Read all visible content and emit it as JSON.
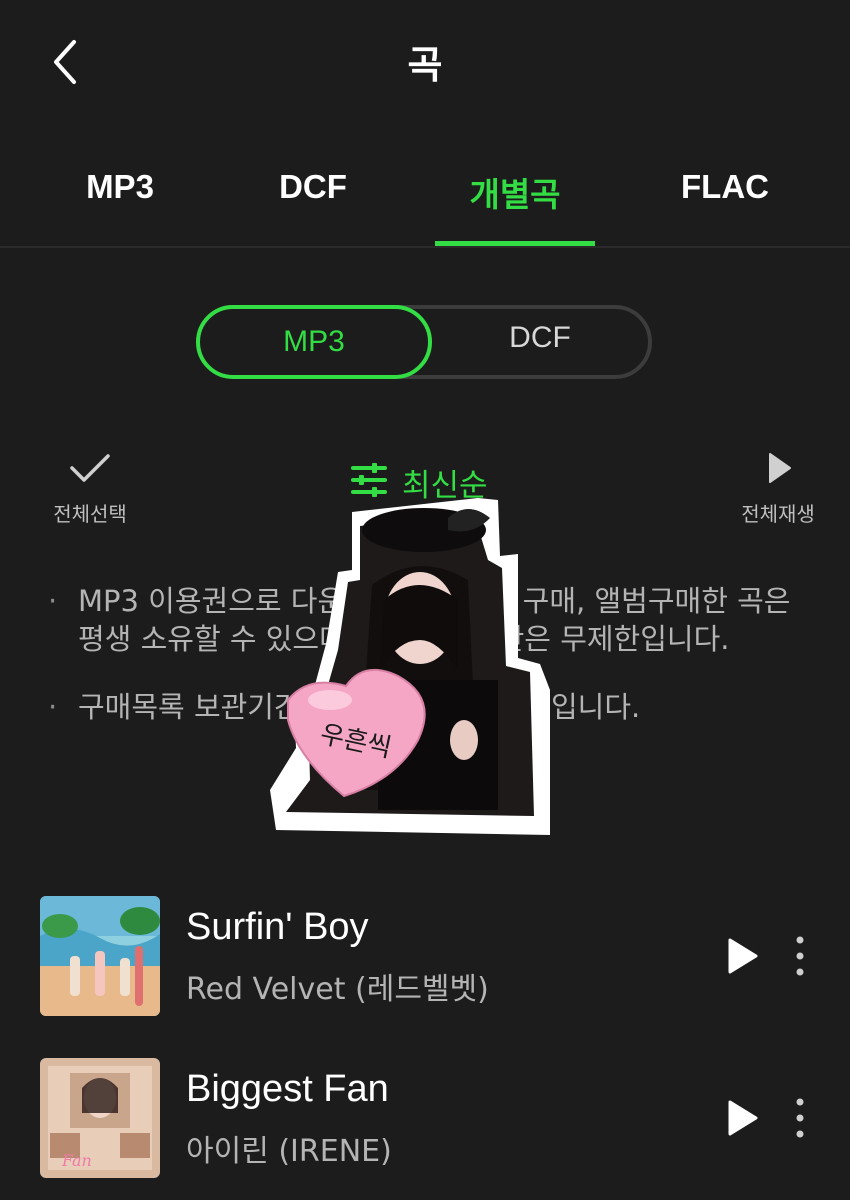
{
  "header": {
    "title": "곡"
  },
  "tabs": [
    {
      "label": "MP3"
    },
    {
      "label": "DCF"
    },
    {
      "label": "개별곡"
    },
    {
      "label": "FLAC"
    }
  ],
  "active_tab": "개별곡",
  "format_toggle": {
    "options": [
      "MP3",
      "DCF"
    ],
    "selected": "MP3"
  },
  "toolbar": {
    "select_all": "전체선택",
    "sort": "최신순",
    "play_all": "전체재생"
  },
  "notes": [
    "MP3 이용권으로 다운로드한 개별곡 구매, 앨범구매한 곡은 평생 소유할 수 있으며 재생 유효기간은 무제한입니다.",
    "구매목록 보관기간은 구매일로부터 1년입니다."
  ],
  "songs": [
    {
      "title": "Surfin' Boy",
      "artist": "Red Velvet (레드벨벳)"
    },
    {
      "title": "Biggest Fan",
      "artist": "아이린 (IRENE)"
    }
  ],
  "sticker": {
    "balloon_text": "우흔씩"
  },
  "colors": {
    "accent": "#33dd44",
    "background": "#1c1c1c",
    "muted_text": "#b4b4b4"
  }
}
